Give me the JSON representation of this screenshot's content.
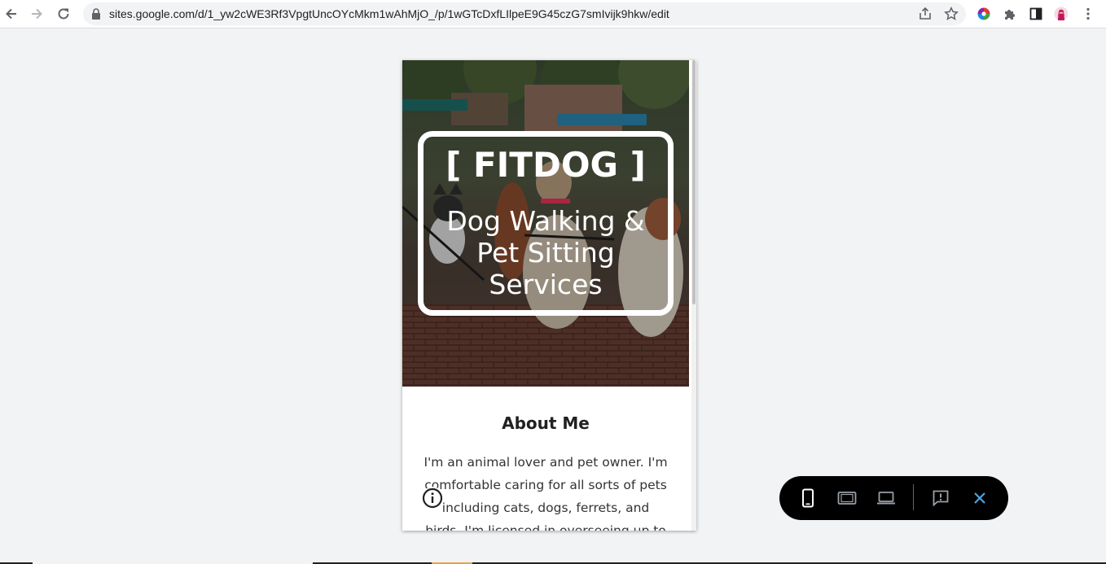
{
  "browser": {
    "url": "sites.google.com/d/1_yw2cWE3Rf3VpgtUncOYcMkm1wAhMjO_/p/1wGTcDxfLIlpeE9G45czG7smIvijk9hkw/edit",
    "icons": {
      "back": "arrow-left-icon",
      "forward": "arrow-right-icon",
      "reload": "reload-icon",
      "lock": "lock-icon",
      "share": "share-icon",
      "bookmark": "star-icon",
      "extension_color": "color-wheel-extension-icon",
      "extensions": "puzzle-icon",
      "side_panel": "side-panel-icon",
      "profile": "profile-avatar-icon",
      "menu": "kebab-menu-icon"
    }
  },
  "site": {
    "hero": {
      "title": "[ FITDOG ]",
      "subtitle": "Dog Walking & Pet Sitting Services"
    },
    "about": {
      "heading": "About Me",
      "body": "I'm an animal lover and pet owner. I'm comfortable caring for all sorts of pets including cats, dogs, ferrets, and birds. I'm licensed in overseeing up to ten"
    },
    "info_icon": "info-icon"
  },
  "preview_toolbar": {
    "buttons": [
      {
        "name": "phone-preview",
        "icon": "phone-icon",
        "active": true
      },
      {
        "name": "tablet-preview",
        "icon": "tablet-icon",
        "active": false
      },
      {
        "name": "desktop-preview",
        "icon": "laptop-icon",
        "active": false
      },
      {
        "name": "report-issue",
        "icon": "feedback-icon",
        "active": false
      },
      {
        "name": "close-preview",
        "icon": "close-icon",
        "active": false
      }
    ]
  },
  "colors": {
    "page_background": "#f1f3f4",
    "device_bar": "#000000",
    "close_accent": "#4fa3e0",
    "hero_text": "#ffffff"
  }
}
